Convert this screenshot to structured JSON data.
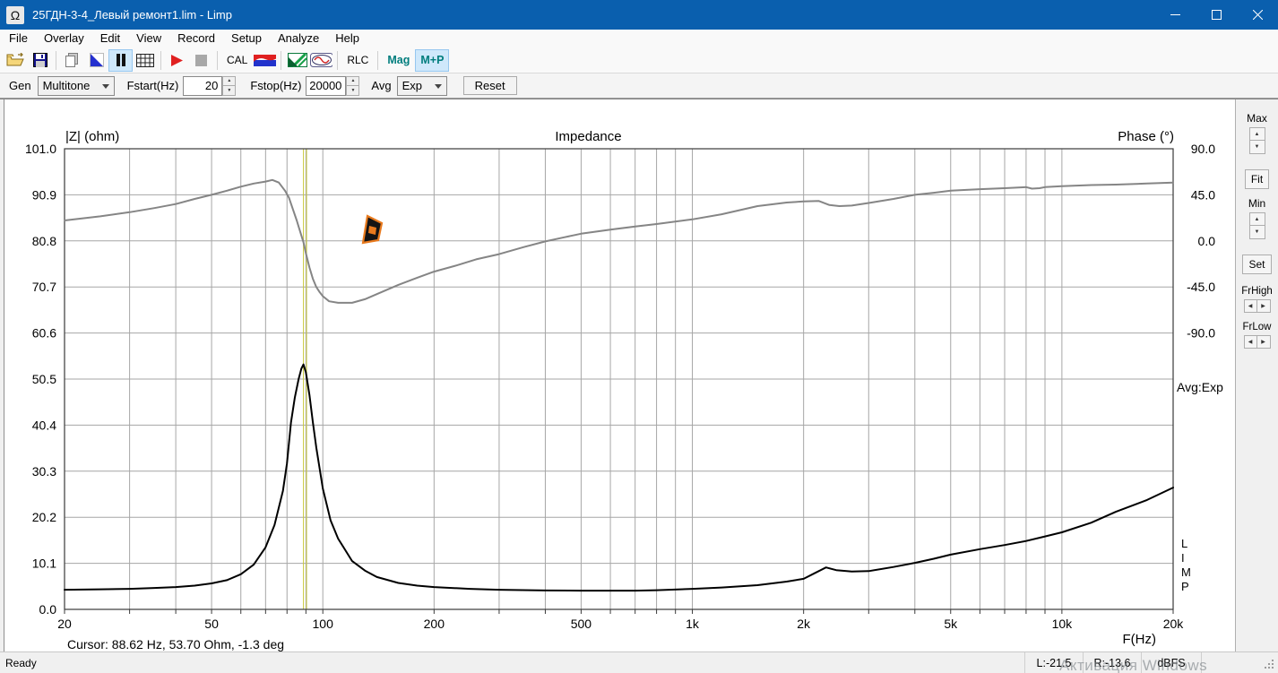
{
  "window": {
    "title": "25ГДН-3-4_Левый ремонт1.lim - Limp",
    "icon_glyph": "Ω"
  },
  "menu": {
    "items": [
      "File",
      "Overlay",
      "Edit",
      "View",
      "Record",
      "Setup",
      "Analyze",
      "Help"
    ]
  },
  "toolbar": {
    "cal_label": "CAL",
    "rlc_label": "RLC",
    "mag_label": "Mag",
    "mp_label": "M+P"
  },
  "gen_bar": {
    "gen_label": "Gen",
    "gen_value": "Multitone",
    "fstart_label": "Fstart(Hz)",
    "fstart_value": "20",
    "fstop_label": "Fstop(Hz)",
    "fstop_value": "20000",
    "avg_label": "Avg",
    "avg_value": "Exp",
    "reset_label": "Reset"
  },
  "side_panel": {
    "max_label": "Max",
    "fit_label": "Fit",
    "min_label": "Min",
    "set_label": "Set",
    "frhigh_label": "FrHigh",
    "frlow_label": "FrLow"
  },
  "chart": {
    "title": "Impedance",
    "z_axis_title": "|Z| (ohm)",
    "phase_axis_title": "Phase (°)",
    "x_axis_title": "F(Hz)",
    "avg_text": "Avg:Exp",
    "limp_vertical": "L\nI\nM\nP",
    "cursor_readout": "Cursor: 88.62 Hz, 53.70 Ohm, -1.3 deg"
  },
  "chart_data": {
    "type": "line",
    "x_scale": "log",
    "grid": true,
    "x_axis": {
      "min": 20,
      "max": 20000,
      "gridline_freqs": [
        20,
        30,
        40,
        50,
        60,
        70,
        80,
        90,
        100,
        200,
        300,
        400,
        500,
        600,
        700,
        800,
        900,
        1000,
        2000,
        3000,
        4000,
        5000,
        6000,
        7000,
        8000,
        9000,
        10000,
        20000
      ],
      "labels": [
        {
          "f": 20,
          "text": "20"
        },
        {
          "f": 50,
          "text": "50"
        },
        {
          "f": 100,
          "text": "100"
        },
        {
          "f": 200,
          "text": "200"
        },
        {
          "f": 500,
          "text": "500"
        },
        {
          "f": 1000,
          "text": "1k"
        },
        {
          "f": 2000,
          "text": "2k"
        },
        {
          "f": 5000,
          "text": "5k"
        },
        {
          "f": 10000,
          "text": "10k"
        },
        {
          "f": 20000,
          "text": "20k"
        }
      ]
    },
    "z_axis": {
      "min": 0,
      "max": 101,
      "ticks": [
        "101.0",
        "90.9",
        "80.8",
        "70.7",
        "60.6",
        "50.5",
        "40.4",
        "30.3",
        "20.2",
        "10.1",
        "0.0"
      ]
    },
    "phase_axis": {
      "min": -90,
      "max": 90,
      "deg_per_div": 45,
      "ticks": [
        "90.0",
        "45.0",
        "0.0",
        "-45.0",
        "-90.0"
      ]
    },
    "cursor": {
      "freq": 88.62,
      "ohm": 53.7,
      "deg": -1.3,
      "color": "#c9c93e"
    },
    "series": [
      {
        "name": "Phase",
        "axis": "phase",
        "color": "#858585",
        "width": 2,
        "points": [
          [
            20,
            20
          ],
          [
            25,
            24
          ],
          [
            30,
            28
          ],
          [
            35,
            32
          ],
          [
            40,
            36
          ],
          [
            45,
            41
          ],
          [
            50,
            45
          ],
          [
            55,
            49
          ],
          [
            60,
            53
          ],
          [
            65,
            56
          ],
          [
            70,
            58
          ],
          [
            73,
            59.5
          ],
          [
            76,
            57
          ],
          [
            79,
            49
          ],
          [
            81,
            42
          ],
          [
            83,
            31
          ],
          [
            85,
            20
          ],
          [
            87,
            8
          ],
          [
            88.62,
            -1.3
          ],
          [
            90,
            -12
          ],
          [
            92,
            -26
          ],
          [
            94,
            -37
          ],
          [
            96,
            -45
          ],
          [
            98,
            -50
          ],
          [
            100,
            -54
          ],
          [
            104,
            -59
          ],
          [
            110,
            -60.5
          ],
          [
            120,
            -60.5
          ],
          [
            130,
            -57
          ],
          [
            140,
            -52
          ],
          [
            160,
            -43
          ],
          [
            180,
            -36
          ],
          [
            200,
            -30
          ],
          [
            230,
            -24
          ],
          [
            260,
            -18
          ],
          [
            300,
            -13
          ],
          [
            350,
            -6
          ],
          [
            400,
            -0.5
          ],
          [
            450,
            3.5
          ],
          [
            500,
            7
          ],
          [
            600,
            11
          ],
          [
            700,
            14
          ],
          [
            800,
            16.5
          ],
          [
            1000,
            21
          ],
          [
            1200,
            26
          ],
          [
            1500,
            34
          ],
          [
            1800,
            37.5
          ],
          [
            2000,
            38.5
          ],
          [
            2200,
            39
          ],
          [
            2350,
            35
          ],
          [
            2500,
            34
          ],
          [
            2700,
            34.5
          ],
          [
            3000,
            37
          ],
          [
            3500,
            41
          ],
          [
            4000,
            45
          ],
          [
            4500,
            47
          ],
          [
            5000,
            49
          ],
          [
            6000,
            50.5
          ],
          [
            7000,
            51.5
          ],
          [
            8000,
            52.5
          ],
          [
            8300,
            51
          ],
          [
            8700,
            51.5
          ],
          [
            9000,
            52.5
          ],
          [
            10000,
            53.5
          ],
          [
            12000,
            54.5
          ],
          [
            14000,
            55
          ],
          [
            17000,
            56
          ],
          [
            20000,
            57
          ]
        ]
      },
      {
        "name": "Impedance |Z|",
        "axis": "z",
        "color": "#000000",
        "width": 2,
        "points": [
          [
            20,
            4.3
          ],
          [
            25,
            4.4
          ],
          [
            30,
            4.5
          ],
          [
            35,
            4.7
          ],
          [
            40,
            4.9
          ],
          [
            45,
            5.2
          ],
          [
            50,
            5.7
          ],
          [
            55,
            6.4
          ],
          [
            60,
            7.7
          ],
          [
            65,
            9.8
          ],
          [
            70,
            13.6
          ],
          [
            74,
            18.5
          ],
          [
            78,
            26
          ],
          [
            80,
            32
          ],
          [
            82,
            41
          ],
          [
            84,
            46.5
          ],
          [
            86,
            50.5
          ],
          [
            87.5,
            52.8
          ],
          [
            88.62,
            53.7
          ],
          [
            90,
            52
          ],
          [
            92,
            47
          ],
          [
            94,
            41
          ],
          [
            96,
            35.5
          ],
          [
            100,
            26.5
          ],
          [
            105,
            19.5
          ],
          [
            110,
            15.5
          ],
          [
            120,
            10.6
          ],
          [
            130,
            8.5
          ],
          [
            140,
            7.1
          ],
          [
            160,
            5.8
          ],
          [
            180,
            5.2
          ],
          [
            200,
            4.9
          ],
          [
            250,
            4.5
          ],
          [
            300,
            4.3
          ],
          [
            400,
            4.15
          ],
          [
            500,
            4.1
          ],
          [
            600,
            4.1
          ],
          [
            700,
            4.1
          ],
          [
            800,
            4.2
          ],
          [
            1000,
            4.5
          ],
          [
            1200,
            4.8
          ],
          [
            1500,
            5.3
          ],
          [
            1800,
            6.1
          ],
          [
            2000,
            6.7
          ],
          [
            2150,
            8
          ],
          [
            2300,
            9.2
          ],
          [
            2450,
            8.6
          ],
          [
            2700,
            8.3
          ],
          [
            3000,
            8.4
          ],
          [
            3500,
            9.3
          ],
          [
            4000,
            10.2
          ],
          [
            4500,
            11.1
          ],
          [
            5000,
            12
          ],
          [
            6000,
            13.2
          ],
          [
            7000,
            14.1
          ],
          [
            8000,
            15
          ],
          [
            9000,
            16
          ],
          [
            10000,
            16.9
          ],
          [
            12000,
            19
          ],
          [
            14000,
            21.4
          ],
          [
            17000,
            24
          ],
          [
            20000,
            26.7
          ]
        ]
      }
    ]
  },
  "status_bar": {
    "ready": "Ready",
    "left_level": "L:-21.5",
    "right_level": "R:-13.6",
    "unit": "dBFS",
    "watermark": "Активация Windows"
  }
}
